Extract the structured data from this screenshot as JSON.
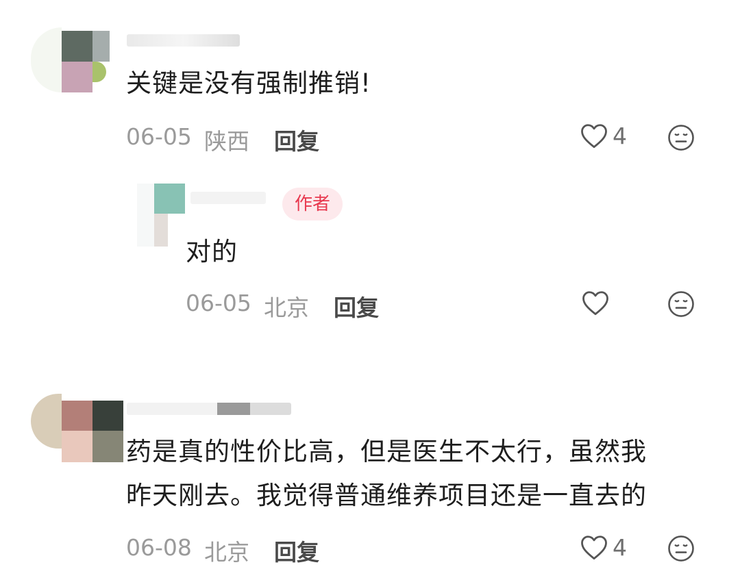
{
  "comments": [
    {
      "text": "关键是没有强制推销!",
      "date": "06-05",
      "location": "陕西",
      "reply_label": "回复",
      "like_count": "4",
      "replies": [
        {
          "badge": "作者",
          "text": "对的",
          "date": "06-05",
          "location": "北京",
          "reply_label": "回复"
        }
      ]
    },
    {
      "text_line1": "药是真的性价比高，但是医生不太行，虽然我",
      "text_line2": "昨天刚去。我觉得普通维养项目还是一直去的",
      "date": "06-08",
      "location": "北京",
      "reply_label": "回复",
      "like_count": "4"
    }
  ],
  "icons": {
    "like": "heart-outline-icon",
    "dislike": "meh-face-icon"
  },
  "colors": {
    "author_badge_bg": "#fde9ec",
    "author_badge_text": "#e8394f",
    "meta": "#9a9a9a"
  }
}
